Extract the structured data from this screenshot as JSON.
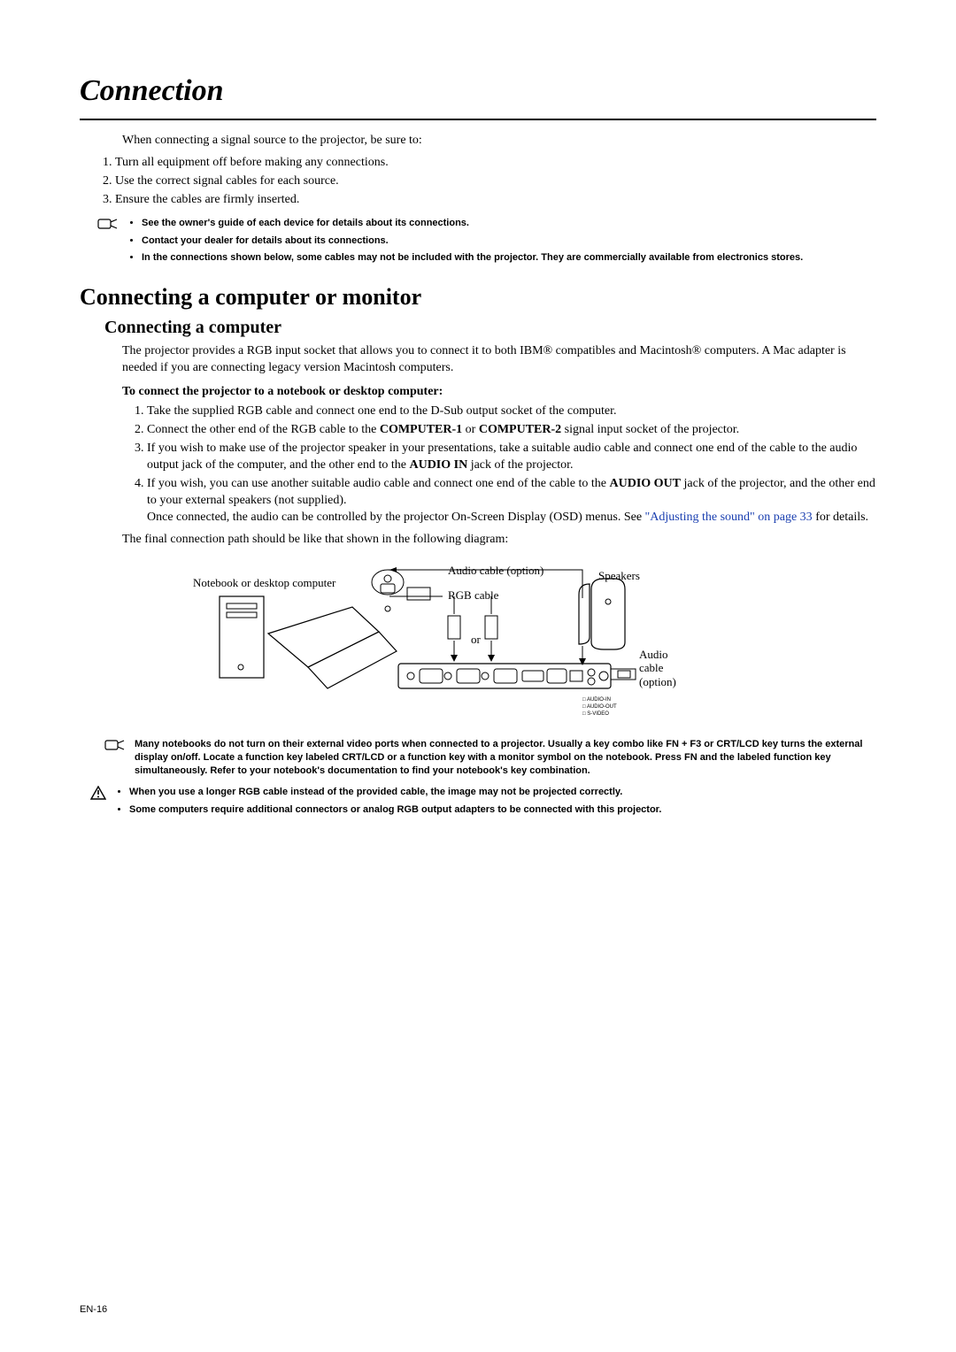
{
  "title": "Connection",
  "intro": "When connecting a signal source to the projector, be sure to:",
  "intro_list": [
    "Turn all equipment off before making any connections.",
    "Use the correct signal cables for each source.",
    "Ensure the cables are firmly inserted."
  ],
  "note1": [
    "See the owner's guide of each device for details about its connections.",
    "Contact your dealer for details about its connections.",
    "In the connections shown below, some cables may not be included with the projector. They are commercially available from electronics stores."
  ],
  "h2": "Connecting a computer or monitor",
  "h3": "Connecting a computer",
  "p1": "The projector provides a RGB input socket that allows you to connect it to both IBM® compatibles and Macintosh® computers. A Mac adapter is needed if you are connecting legacy version Macintosh computers.",
  "subhead": "To connect the projector to a notebook or desktop computer:",
  "steps": {
    "s1": "Take the supplied RGB cable and connect one end to the D-Sub output socket of the computer.",
    "s2a": "Connect the other end of the RGB cable to the ",
    "s2b": "COMPUTER-1",
    "s2c": " or ",
    "s2d": "COMPUTER-2",
    "s2e": " signal input socket of the projector.",
    "s3a": "If you wish to make use of the projector speaker in your presentations, take a suitable audio cable and connect one end of the cable to the audio output jack of the computer, and the other end to the ",
    "s3b": "AUDIO IN",
    "s3c": " jack of the projector.",
    "s4a": "If you wish, you can use another suitable audio cable and connect one end of the cable to the ",
    "s4b": "AUDIO OUT",
    "s4c": " jack of the projector, and the other end to your external speakers (not supplied).",
    "s4d": "Once connected, the audio can be controlled by the projector On-Screen Display (OSD) menus. See ",
    "s4link": "\"Adjusting the sound\" on page 33",
    "s4e": " for details."
  },
  "final_line": "The final connection path should be like that shown in the following diagram:",
  "diagram": {
    "notebook_label": "Notebook or desktop computer",
    "audio_cable_option": "Audio cable (option)",
    "rgb_cable": "RGB cable",
    "or": "or",
    "speakers": "Speakers",
    "audio_cable_option2": "Audio cable (option)",
    "ports_caption": [
      "AUDIO-IN",
      "AUDIO-OUT",
      "S-VIDEO"
    ]
  },
  "bottom_note": "Many notebooks do not turn on their external video ports when connected to a projector. Usually a key combo like FN + F3 or CRT/LCD key turns the external display on/off. Locate a function key labeled CRT/LCD or a function key with a monitor symbol on the notebook. Press FN and the labeled function key simultaneously. Refer to your notebook's documentation to find your notebook's key combination.",
  "warn_list": [
    "When you use a longer RGB cable instead of the provided cable, the image may not be projected correctly.",
    "Some computers require additional connectors or analog RGB output adapters to be connected with this projector."
  ],
  "page_num": "EN-16"
}
